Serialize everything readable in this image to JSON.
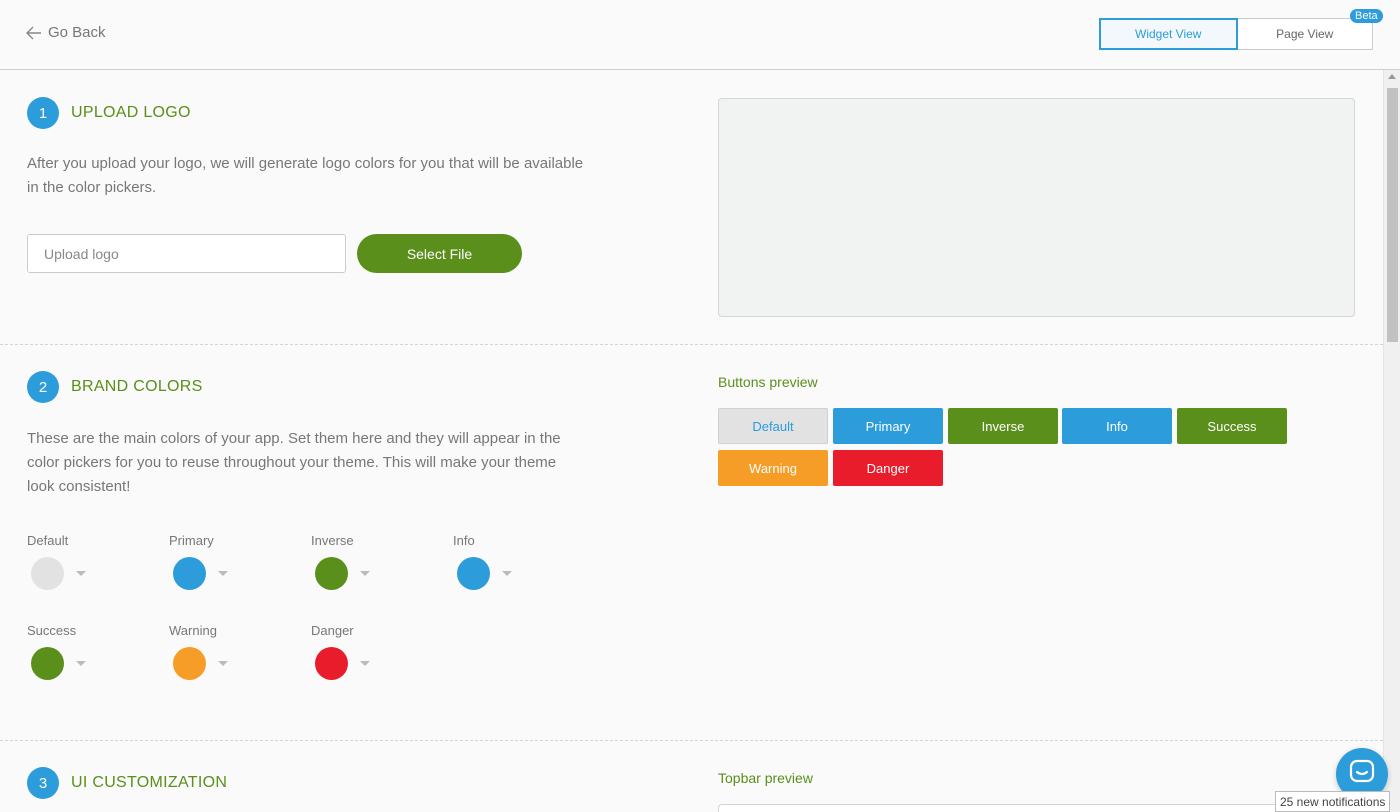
{
  "header": {
    "go_back": "Go Back",
    "views": [
      "Widget View",
      "Page View"
    ],
    "active_view": "Widget View",
    "beta_badge": "Beta"
  },
  "sections": [
    {
      "number": "1",
      "title": "UPLOAD LOGO",
      "description_lines": [
        "After you upload your logo, we will generate logo colors for you that will be available",
        "in the color pickers."
      ],
      "upload_placeholder": "Upload logo",
      "select_file": "Select File"
    },
    {
      "number": "2",
      "title": "BRAND COLORS",
      "description_lines": [
        "These are the main colors of your app. Set them here and they will appear in the",
        "color pickers for you to reuse throughout your theme. This will make your theme",
        "look consistent!"
      ],
      "colors": [
        {
          "label": "Default",
          "color": "#e2e2e2"
        },
        {
          "label": "Primary",
          "color": "#2d9cdb"
        },
        {
          "label": "Inverse",
          "color": "#5a8f1b"
        },
        {
          "label": "Info",
          "color": "#2d9cdb"
        },
        {
          "label": "Success",
          "color": "#5a8f1b"
        },
        {
          "label": "Warning",
          "color": "#f59d27"
        },
        {
          "label": "Danger",
          "color": "#e81c2b"
        }
      ],
      "preview_title": "Buttons preview",
      "preview_buttons": [
        {
          "label": "Default",
          "bg": "#e2e2e2",
          "fg": "#2d9cdb"
        },
        {
          "label": "Primary",
          "bg": "#2d9cdb",
          "fg": "#ffffff"
        },
        {
          "label": "Inverse",
          "bg": "#5a8f1b",
          "fg": "#ffffff"
        },
        {
          "label": "Info",
          "bg": "#2d9cdb",
          "fg": "#ffffff"
        },
        {
          "label": "Success",
          "bg": "#5a8f1b",
          "fg": "#ffffff"
        },
        {
          "label": "Warning",
          "bg": "#f59d27",
          "fg": "#ffffff"
        },
        {
          "label": "Danger",
          "bg": "#e81c2b",
          "fg": "#ffffff"
        }
      ]
    },
    {
      "number": "3",
      "title": "UI CUSTOMIZATION",
      "preview_title": "Topbar preview"
    }
  ],
  "chat": {
    "icon": "chat-icon",
    "notifications": "25 new notifications"
  },
  "colors": {
    "accent": "#2d9cdb",
    "brand_green": "#5a8f1b"
  }
}
